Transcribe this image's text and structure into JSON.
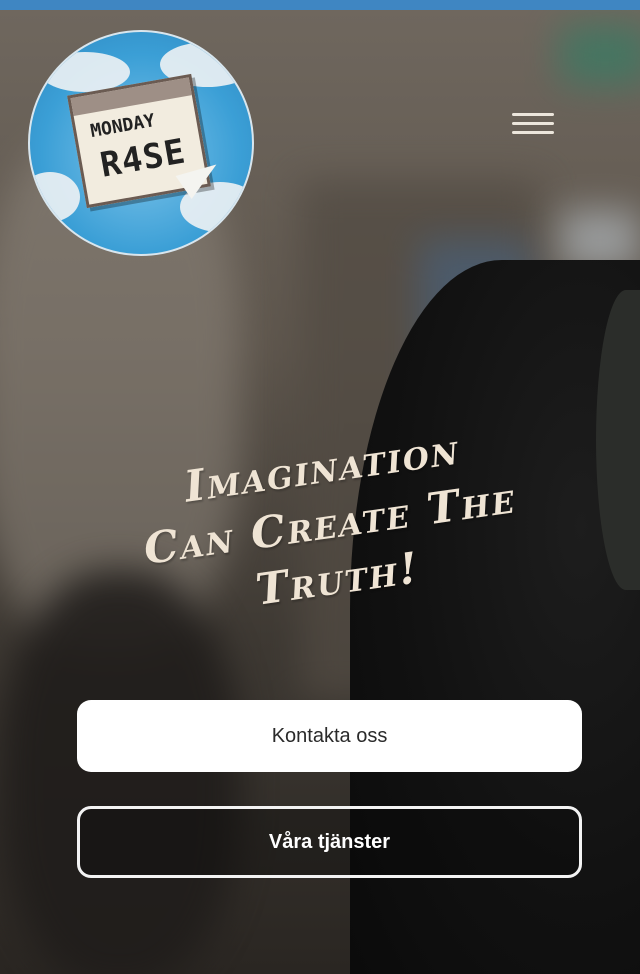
{
  "header": {
    "logo": {
      "line1": "MONDAY",
      "line2": "R4SE"
    },
    "menu_icon": "hamburger-menu-icon"
  },
  "hero": {
    "tagline": [
      "Imagination",
      "Can Create The",
      "Truth!"
    ],
    "buttons": {
      "contact_label": "Kontakta oss",
      "services_label": "Våra tjänster"
    }
  },
  "colors": {
    "top_bar": "#3f86c2",
    "tagline": "#efe4d4",
    "primary_button_bg": "#ffffff",
    "outline_button_border": "#f3f3f3"
  }
}
